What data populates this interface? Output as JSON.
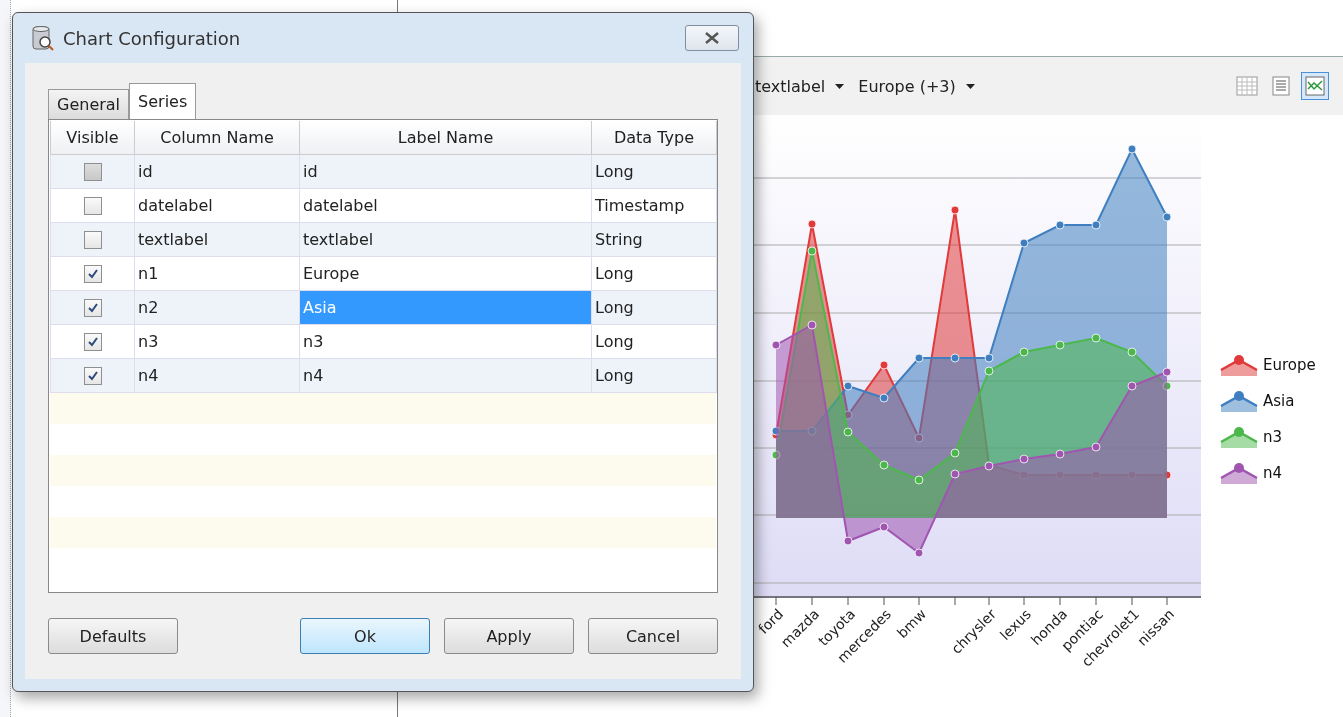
{
  "app": {
    "toolbar": {
      "dropdowns": [
        {
          "label": "textlabel"
        },
        {
          "label": "Europe (+3)"
        }
      ],
      "views": [
        {
          "kind": "table",
          "selected": false
        },
        {
          "kind": "text",
          "selected": false
        },
        {
          "kind": "chart",
          "selected": true
        }
      ]
    },
    "chart": {
      "categories": [
        "ford",
        "mazda",
        "toyota",
        "mercedes",
        "bmw",
        "chrysler",
        "lexus",
        "honda",
        "pontiac",
        "chevrolet1",
        "nissan"
      ],
      "legend": [
        {
          "label": "Europe",
          "color": "#e03a3a"
        },
        {
          "label": "Asia",
          "color": "#3f7fbf"
        },
        {
          "label": "n3",
          "color": "#4cb84c"
        },
        {
          "label": "n4",
          "color": "#a055b0"
        }
      ]
    }
  },
  "dialog": {
    "title": "Chart Configuration",
    "tabs": [
      {
        "label": "General",
        "selected": false
      },
      {
        "label": "Series",
        "selected": true
      }
    ],
    "columns": [
      "Visible",
      "Column Name",
      "Label Name",
      "Data Type"
    ],
    "rows": [
      {
        "checked": false,
        "disabled": true,
        "column": "id",
        "label": "id",
        "type": "Long",
        "selected": false
      },
      {
        "checked": false,
        "disabled": false,
        "column": "datelabel",
        "label": "datelabel",
        "type": "Timestamp",
        "selected": false
      },
      {
        "checked": false,
        "disabled": false,
        "column": "textlabel",
        "label": "textlabel",
        "type": "String",
        "selected": false
      },
      {
        "checked": true,
        "disabled": false,
        "column": "n1",
        "label": "Europe",
        "type": "Long",
        "selected": false
      },
      {
        "checked": true,
        "disabled": false,
        "column": "n2",
        "label": "Asia",
        "type": "Long",
        "selected": true
      },
      {
        "checked": true,
        "disabled": false,
        "column": "n3",
        "label": "n3",
        "type": "Long",
        "selected": false
      },
      {
        "checked": true,
        "disabled": false,
        "column": "n4",
        "label": "n4",
        "type": "Long",
        "selected": false
      }
    ],
    "buttons": [
      {
        "label": "Defaults",
        "kind": "left",
        "selected": false
      },
      {
        "label": "Ok",
        "kind": "right",
        "selected": true
      },
      {
        "label": "Apply",
        "kind": "right",
        "selected": false
      },
      {
        "label": "Cancel",
        "kind": "right",
        "selected": false
      }
    ]
  }
}
